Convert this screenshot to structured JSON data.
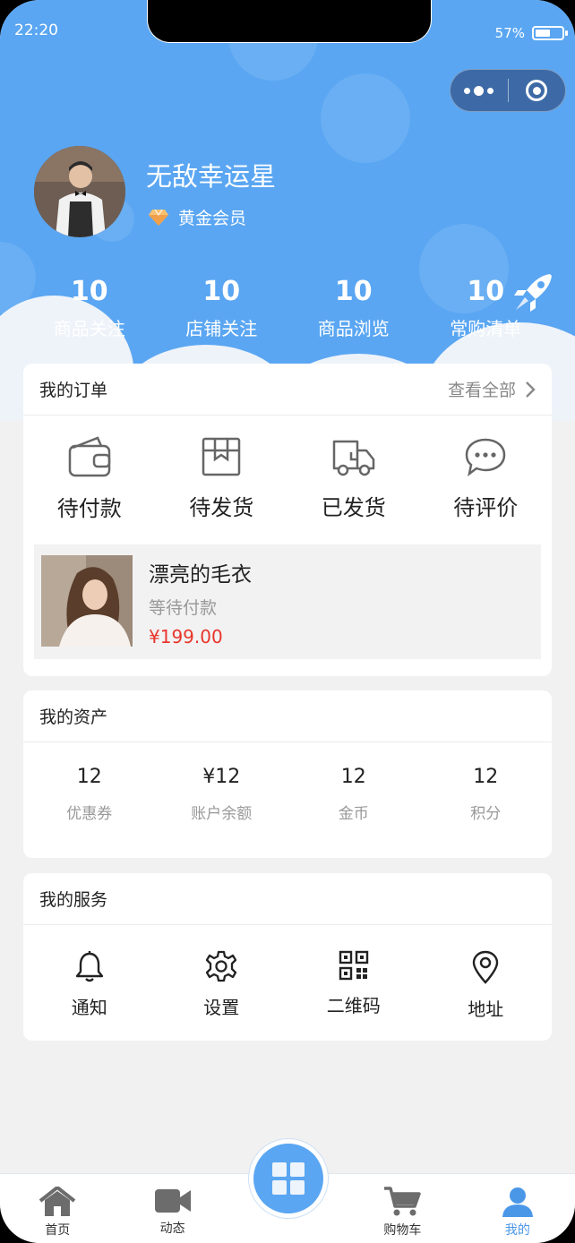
{
  "status_bar": {
    "time": "22:20",
    "battery": "57%",
    "battery_level": 0.57
  },
  "user": {
    "name": "无敌幸运星",
    "level": "黄金会员"
  },
  "stats": [
    {
      "value": "10",
      "label": "商品关注"
    },
    {
      "value": "10",
      "label": "店铺关注"
    },
    {
      "value": "10",
      "label": "商品浏览"
    },
    {
      "value": "10",
      "label": "常购清单"
    }
  ],
  "orders": {
    "title": "我的订单",
    "view_all": "查看全部",
    "items": [
      {
        "label": "待付款",
        "icon": "wallet-icon"
      },
      {
        "label": "待发货",
        "icon": "box-icon"
      },
      {
        "label": "已发货",
        "icon": "truck-icon"
      },
      {
        "label": "待评价",
        "icon": "comment-icon"
      }
    ],
    "product": {
      "name": "漂亮的毛衣",
      "status": "等待付款",
      "price": "¥199.00"
    }
  },
  "assets": {
    "title": "我的资产",
    "items": [
      {
        "value": "12",
        "label": "优惠券"
      },
      {
        "value": "¥12",
        "label": "账户余额"
      },
      {
        "value": "12",
        "label": "金币"
      },
      {
        "value": "12",
        "label": "积分"
      }
    ]
  },
  "services": {
    "title": "我的服务",
    "items": [
      {
        "label": "通知",
        "icon": "bell-icon"
      },
      {
        "label": "设置",
        "icon": "gear-icon"
      },
      {
        "label": "二维码",
        "icon": "qrcode-icon"
      },
      {
        "label": "地址",
        "icon": "location-icon"
      }
    ]
  },
  "tabbar": {
    "items": [
      {
        "label": "首页",
        "icon": "home-icon"
      },
      {
        "label": "动态",
        "icon": "video-icon"
      },
      {
        "label": "",
        "icon": "grid-icon"
      },
      {
        "label": "购物车",
        "icon": "cart-icon"
      },
      {
        "label": "我的",
        "icon": "user-icon"
      }
    ],
    "active": "我的"
  },
  "colors": {
    "primary": "#5aa6f2",
    "price": "#e8352b",
    "active_tab": "#4a97e8"
  }
}
